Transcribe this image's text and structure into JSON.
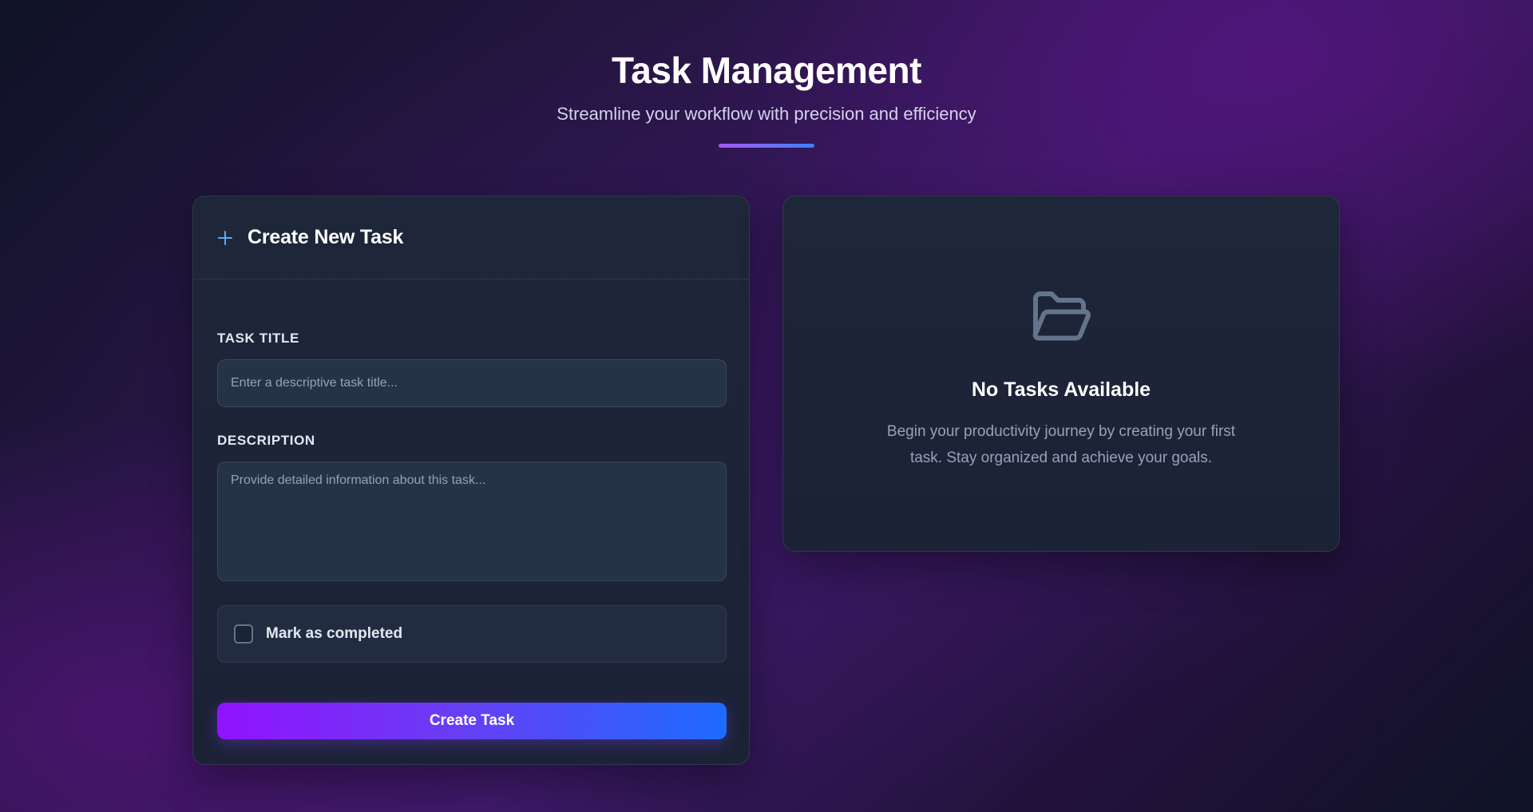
{
  "header": {
    "title": "Task Management",
    "subtitle": "Streamline your workflow with precision and efficiency"
  },
  "form": {
    "heading": "Create New Task",
    "icon": "plus-icon",
    "title_label": "TASK TITLE",
    "title_placeholder": "Enter a descriptive task title...",
    "title_value": "",
    "description_label": "DESCRIPTION",
    "description_placeholder": "Provide detailed information about this task...",
    "description_value": "",
    "completed_label": "Mark as completed",
    "completed_checked": false,
    "submit_label": "Create Task"
  },
  "empty_state": {
    "icon": "folder-open-icon",
    "title": "No Tasks Available",
    "message": "Begin your productivity journey by creating your first task. Stay organized and achieve your goals."
  },
  "colors": {
    "accent_start": "#9013fe",
    "accent_end": "#1d6bff",
    "card_bg": "#1e2639",
    "input_bg": "#253247",
    "muted_text": "#94a3b8"
  }
}
